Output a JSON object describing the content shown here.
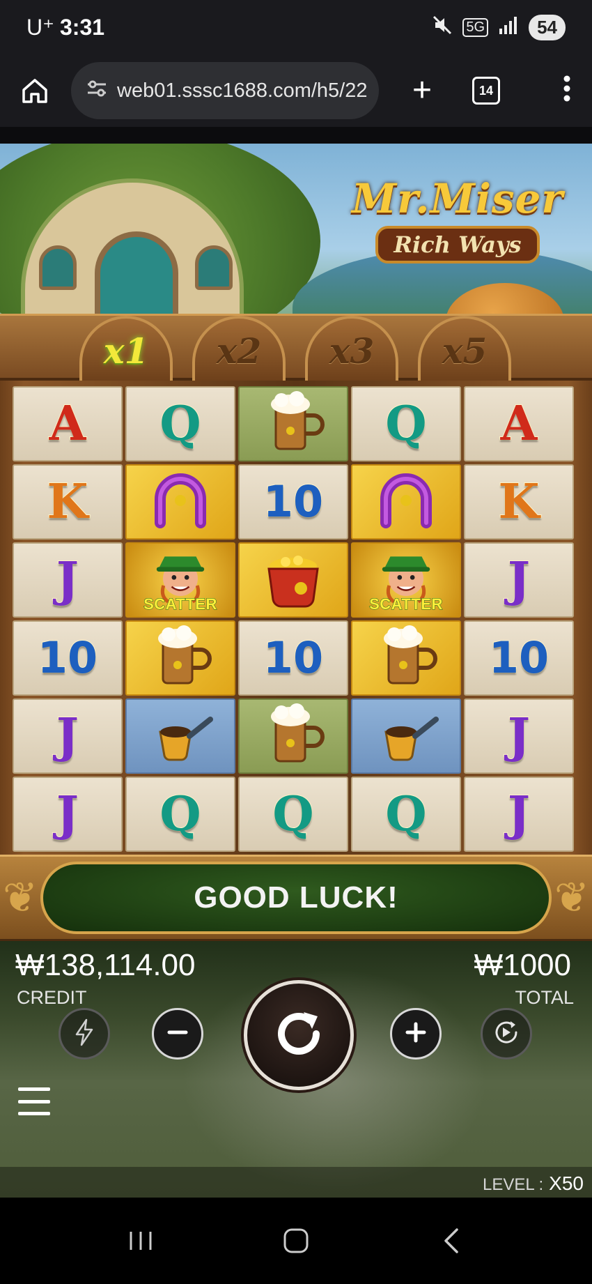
{
  "status_bar": {
    "carrier": "U⁺",
    "time": "3:31",
    "mute_icon": "mute-icon",
    "network_label": "5G",
    "battery": "54"
  },
  "browser": {
    "url": "web01.sssc1688.com/h5/22",
    "tab_count": "14",
    "icons": [
      "home-icon",
      "site-settings-icon",
      "new-tab-icon",
      "tabs-icon",
      "overflow-menu-icon"
    ]
  },
  "game": {
    "logo_title": "Mr.Miser",
    "logo_subtitle": "Rich Ways",
    "multipliers": [
      {
        "label": "x1",
        "active": true
      },
      {
        "label": "x2",
        "active": false
      },
      {
        "label": "x3",
        "active": false
      },
      {
        "label": "x5",
        "active": false
      }
    ],
    "scatter_label": "SCATTER",
    "reels": [
      [
        "A",
        "Q",
        "beer",
        "Q",
        "A"
      ],
      [
        "K",
        "horseshoe",
        "10",
        "horseshoe",
        "K"
      ],
      [
        "J",
        "scatter",
        "pot",
        "scatter",
        "J"
      ],
      [
        "10",
        "beer-gold",
        "10",
        "beer-gold",
        "10"
      ],
      [
        "J",
        "pipe",
        "beer",
        "pipe",
        "J"
      ],
      [
        "J",
        "Q",
        "Q",
        "Q",
        "J"
      ]
    ],
    "message": "GOOD LUCK!",
    "credit_value": "₩138,114.00",
    "credit_label": "CREDIT",
    "total_value": "₩1000",
    "total_label": "TOTAL",
    "level_label": "LEVEL :",
    "level_value": "X50",
    "controls": [
      "turbo-icon",
      "minus-icon",
      "spin-icon",
      "plus-icon",
      "autoplay-icon",
      "menu-icon"
    ]
  },
  "nav_bar": {
    "icons": [
      "recent-apps-icon",
      "home-nav-icon",
      "back-icon"
    ]
  },
  "colors": {
    "accent_gold": "#f7c93a",
    "banner_green": "#2f5a1e",
    "frame_wood": "#8a5628"
  }
}
